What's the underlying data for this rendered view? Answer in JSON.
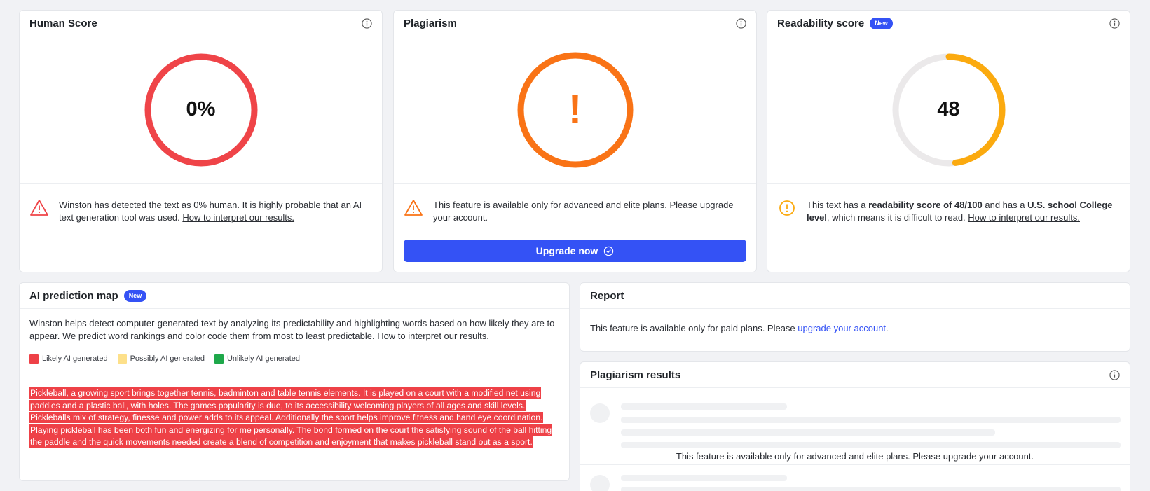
{
  "human_score": {
    "title": "Human Score",
    "value": "0%",
    "percent": 0,
    "ring_color": "#ef4448",
    "message": "Winston has detected the text as 0% human. It is highly probable that an AI text generation tool was used.",
    "link": "How to interpret our results."
  },
  "plagiarism": {
    "title": "Plagiarism",
    "symbol": "!",
    "ring_color": "#f97316",
    "message": "This feature is available only for advanced and elite plans. Please upgrade your account.",
    "button_label": "Upgrade now"
  },
  "readability": {
    "title": "Readability score",
    "badge": "New",
    "value": "48",
    "score": 48,
    "max": 100,
    "ring_color": "#fbaa0f",
    "track_color": "#ebe9ea",
    "msg_part1": "This text has a ",
    "msg_bold1": "readability score of 48/100",
    "msg_part2": " and has a ",
    "msg_bold2": "U.S. school College level",
    "msg_part3": ", which means it is difficult to read. ",
    "link": "How to interpret our results."
  },
  "prediction_map": {
    "title": "AI prediction map",
    "badge": "New",
    "description": "Winston helps detect computer-generated text by analyzing its predictability and highlighting words based on how likely they are to appear. We predict word rankings and color code them from most to least predictable. ",
    "link": "How to interpret our results.",
    "legend": [
      {
        "label": "Likely AI generated",
        "color": "#ee4147"
      },
      {
        "label": "Possibly AI generated",
        "color": "#fde08a"
      },
      {
        "label": "Unlikely AI generated",
        "color": "#1ea84a"
      }
    ],
    "text": " Pickleball, a growing sport brings together tennis, badminton and table tennis elements. It is played on a court with a modified net using paddles and a plastic ball, with holes. The games popularity is due, to its accessibility welcoming players of all ages and skill levels. Pickleballs mix of strategy, finesse and power adds to its appeal. Additionally the sport helps improve fitness and hand eye coordination. Playing pickleball has been both fun and energizing for me personally. The bond formed on the court the satisfying sound of the ball hitting the paddle and the quick movements needed create a blend of competition and enjoyment that makes pickleball stand out as a sport. "
  },
  "report": {
    "title": "Report",
    "message": "This feature is available only for paid plans. Please ",
    "link": "upgrade your account",
    "suffix": "."
  },
  "plagiarism_results": {
    "title": "Plagiarism results",
    "overlay": "This feature is available only for advanced and elite plans. Please upgrade your account."
  }
}
